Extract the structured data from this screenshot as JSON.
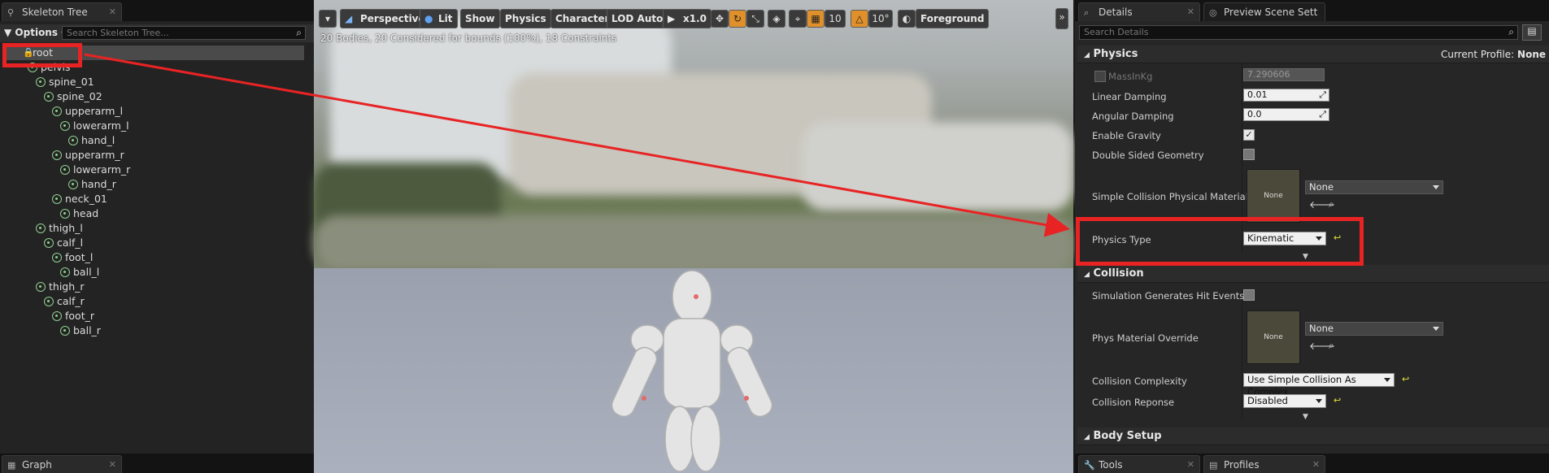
{
  "skeleton_panel": {
    "tab_label": "Skeleton Tree",
    "options_label": "Options",
    "search_placeholder": "Search Skeleton Tree...",
    "bones": [
      {
        "label": "root",
        "indent": 0
      },
      {
        "label": "pelvis",
        "indent": 1
      },
      {
        "label": "spine_01",
        "indent": 2
      },
      {
        "label": "spine_02",
        "indent": 3
      },
      {
        "label": "upperarm_l",
        "indent": 4
      },
      {
        "label": "lowerarm_l",
        "indent": 5
      },
      {
        "label": "hand_l",
        "indent": 6
      },
      {
        "label": "upperarm_r",
        "indent": 4
      },
      {
        "label": "lowerarm_r",
        "indent": 5
      },
      {
        "label": "hand_r",
        "indent": 6
      },
      {
        "label": "neck_01",
        "indent": 4
      },
      {
        "label": "head",
        "indent": 5
      },
      {
        "label": "thigh_l",
        "indent": 2
      },
      {
        "label": "calf_l",
        "indent": 3
      },
      {
        "label": "foot_l",
        "indent": 4
      },
      {
        "label": "ball_l",
        "indent": 5
      },
      {
        "label": "thigh_r",
        "indent": 2
      },
      {
        "label": "calf_r",
        "indent": 3
      },
      {
        "label": "foot_r",
        "indent": 4
      },
      {
        "label": "ball_r",
        "indent": 5
      }
    ],
    "bottom_tab_label": "Graph"
  },
  "viewport": {
    "perspective_label": "Perspective",
    "lit_label": "Lit",
    "show_label": "Show",
    "physics_label": "Physics",
    "character_label": "Character",
    "lod_label": "LOD Auto",
    "speed_label": "x1.0",
    "grid_value": "10",
    "angle_value": "10°",
    "foreground_label": "Foreground",
    "stats_text": "20 Bodies, 20 Considered for bounds (100%), 18 Constraints"
  },
  "details_panel": {
    "tab_details": "Details",
    "tab_preview": "Preview Scene Sett",
    "search_placeholder": "Search Details",
    "physics_section": "Physics",
    "current_profile_label": "Current Profile:",
    "current_profile_value": "None",
    "mass_label": "MassInKg",
    "mass_value": "7.290606",
    "linear_damping_label": "Linear Damping",
    "linear_damping_value": "0.01",
    "angular_damping_label": "Angular Damping",
    "angular_damping_value": "0.0",
    "enable_gravity_label": "Enable Gravity",
    "enable_gravity_checked": true,
    "double_sided_label": "Double Sided Geometry",
    "simple_collision_label": "Simple Collision Physical Material",
    "material_thumb_label": "None",
    "material_combo_value": "None",
    "physics_type_label": "Physics Type",
    "physics_type_value": "Kinematic",
    "collision_section": "Collision",
    "sim_hit_label": "Simulation Generates Hit Events",
    "phys_override_label": "Phys Material Override",
    "phys_override_thumb": "None",
    "phys_override_value": "None",
    "collision_complexity_label": "Collision Complexity",
    "collision_complexity_value": "Use Simple Collision As Complex",
    "collision_response_label": "Collision Reponse",
    "collision_response_value": "Disabled",
    "body_setup_section": "Body Setup",
    "tools_tab": "Tools",
    "profiles_tab": "Profiles"
  },
  "colors": {
    "annotation_red": "#e82324",
    "bone_green": "#8fd08f",
    "reset_yellow": "#e2e23a"
  }
}
